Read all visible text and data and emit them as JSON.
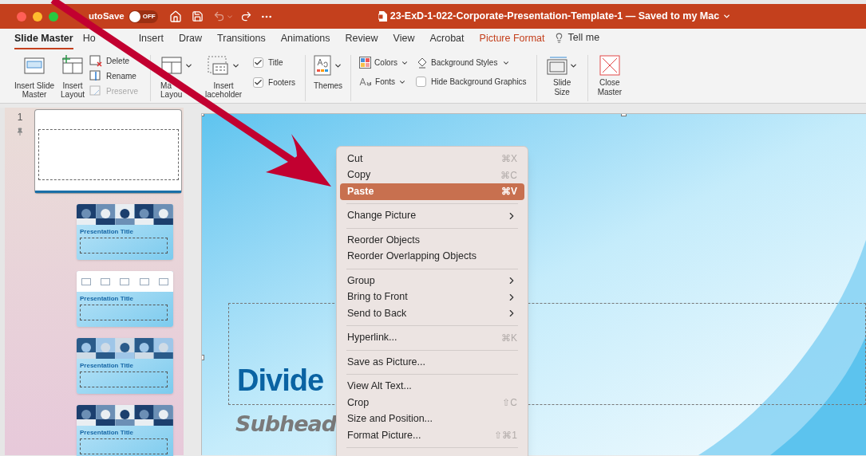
{
  "window": {
    "title": "23-ExD-1-022-Corporate-Presentation-Template-1 — Saved to my Mac",
    "autosave_label": "utoSave",
    "autosave": {
      "on": false,
      "label": "OFF"
    }
  },
  "tabs": [
    {
      "label": "Slide Master",
      "selected": true,
      "kind": "normal"
    },
    {
      "label": "Ho",
      "selected": false,
      "kind": "normal"
    },
    {
      "label": "Insert",
      "selected": false,
      "kind": "normal"
    },
    {
      "label": "Draw",
      "selected": false,
      "kind": "normal"
    },
    {
      "label": "Transitions",
      "selected": false,
      "kind": "normal"
    },
    {
      "label": "Animations",
      "selected": false,
      "kind": "normal"
    },
    {
      "label": "Review",
      "selected": false,
      "kind": "normal"
    },
    {
      "label": "View",
      "selected": false,
      "kind": "normal"
    },
    {
      "label": "Acrobat",
      "selected": false,
      "kind": "normal"
    },
    {
      "label": "Picture Format",
      "selected": false,
      "kind": "contextual"
    }
  ],
  "tell_me": "Tell me",
  "ribbon": {
    "master_buttons": [
      {
        "lines": [
          "Insert Slide",
          "Master"
        ]
      },
      {
        "lines": [
          "Insert",
          "Layout"
        ]
      }
    ],
    "edit_buttons": [
      {
        "label": "Delete",
        "disabled": false
      },
      {
        "label": "Rename",
        "disabled": false
      },
      {
        "label": "Preserve",
        "disabled": true
      }
    ],
    "layout_buttons": [
      {
        "lines": [
          "Ma",
          "Layou"
        ]
      },
      {
        "lines": [
          "Insert",
          "laceholder"
        ]
      }
    ],
    "checkboxes": [
      {
        "label": "Title",
        "checked": true
      },
      {
        "label": "Footers",
        "checked": true
      }
    ],
    "themes": {
      "label": "Themes"
    },
    "colors": {
      "label": "Colors"
    },
    "background_styles": {
      "label": "Background Styles"
    },
    "fonts": {
      "label": "Fonts"
    },
    "hide_background": {
      "label": "Hide Background Graphics",
      "checked": false
    },
    "slide_size": {
      "lines": [
        "Slide",
        "Size"
      ]
    },
    "close_master": {
      "lines": [
        "Close",
        "Master"
      ]
    }
  },
  "slides": [
    {
      "number": "1",
      "kind": "master",
      "selected": true
    },
    {
      "kind": "photos",
      "title": "Presentation Title",
      "selected": false
    },
    {
      "kind": "placeholders",
      "title": "Presentation Title",
      "selected": false
    },
    {
      "kind": "photos",
      "title": "Presentation Title",
      "selected": false
    },
    {
      "kind": "photos",
      "title": "Presentation Title",
      "selected": false
    }
  ],
  "slide": {
    "title": "Divide",
    "subhead": "Subhead"
  },
  "context_menu": [
    [
      {
        "label": "Cut",
        "shortcut": "⌘X",
        "selected": false
      },
      {
        "label": "Copy",
        "shortcut": "⌘C",
        "selected": false
      },
      {
        "label": "Paste",
        "shortcut": "⌘V",
        "selected": true
      }
    ],
    [
      {
        "label": "Change Picture",
        "submenu": true,
        "selected": false
      }
    ],
    [
      {
        "label": "Reorder Objects",
        "selected": false
      },
      {
        "label": "Reorder Overlapping Objects",
        "selected": false
      }
    ],
    [
      {
        "label": "Group",
        "submenu": true,
        "selected": false
      },
      {
        "label": "Bring to Front",
        "submenu": true,
        "selected": false
      },
      {
        "label": "Send to Back",
        "submenu": true,
        "selected": false
      }
    ],
    [
      {
        "label": "Hyperlink...",
        "shortcut": "⌘K",
        "selected": false
      }
    ],
    [
      {
        "label": "Save as Picture...",
        "selected": false
      }
    ],
    [
      {
        "label": "View Alt Text...",
        "selected": false
      },
      {
        "label": "Crop",
        "shortcut": "⇧C",
        "selected": false
      },
      {
        "label": "Size and Position...",
        "selected": false
      },
      {
        "label": "Format Picture...",
        "shortcut": "⇧⌘1",
        "selected": false
      }
    ]
  ]
}
